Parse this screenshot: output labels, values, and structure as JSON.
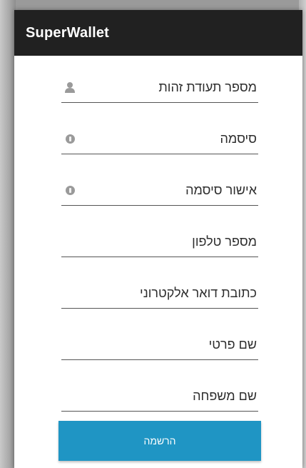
{
  "app": {
    "title": "SuperWallet"
  },
  "form": {
    "fields": [
      {
        "label": "מספר תעודת זהות",
        "icon": "person-icon"
      },
      {
        "label": "סיסמה",
        "icon": "lock-icon"
      },
      {
        "label": "אישור סיסמה",
        "icon": "lock-icon"
      },
      {
        "label": "מספר טלפון",
        "icon": ""
      },
      {
        "label": "כתובת דואר אלקטרוני",
        "icon": ""
      },
      {
        "label": "שם פרטי",
        "icon": ""
      },
      {
        "label": "שם משפחה",
        "icon": ""
      }
    ],
    "submit_label": "הרשמה"
  },
  "colors": {
    "appbar": "#212121",
    "button": "#1f95c4",
    "background": "#ffffff"
  }
}
